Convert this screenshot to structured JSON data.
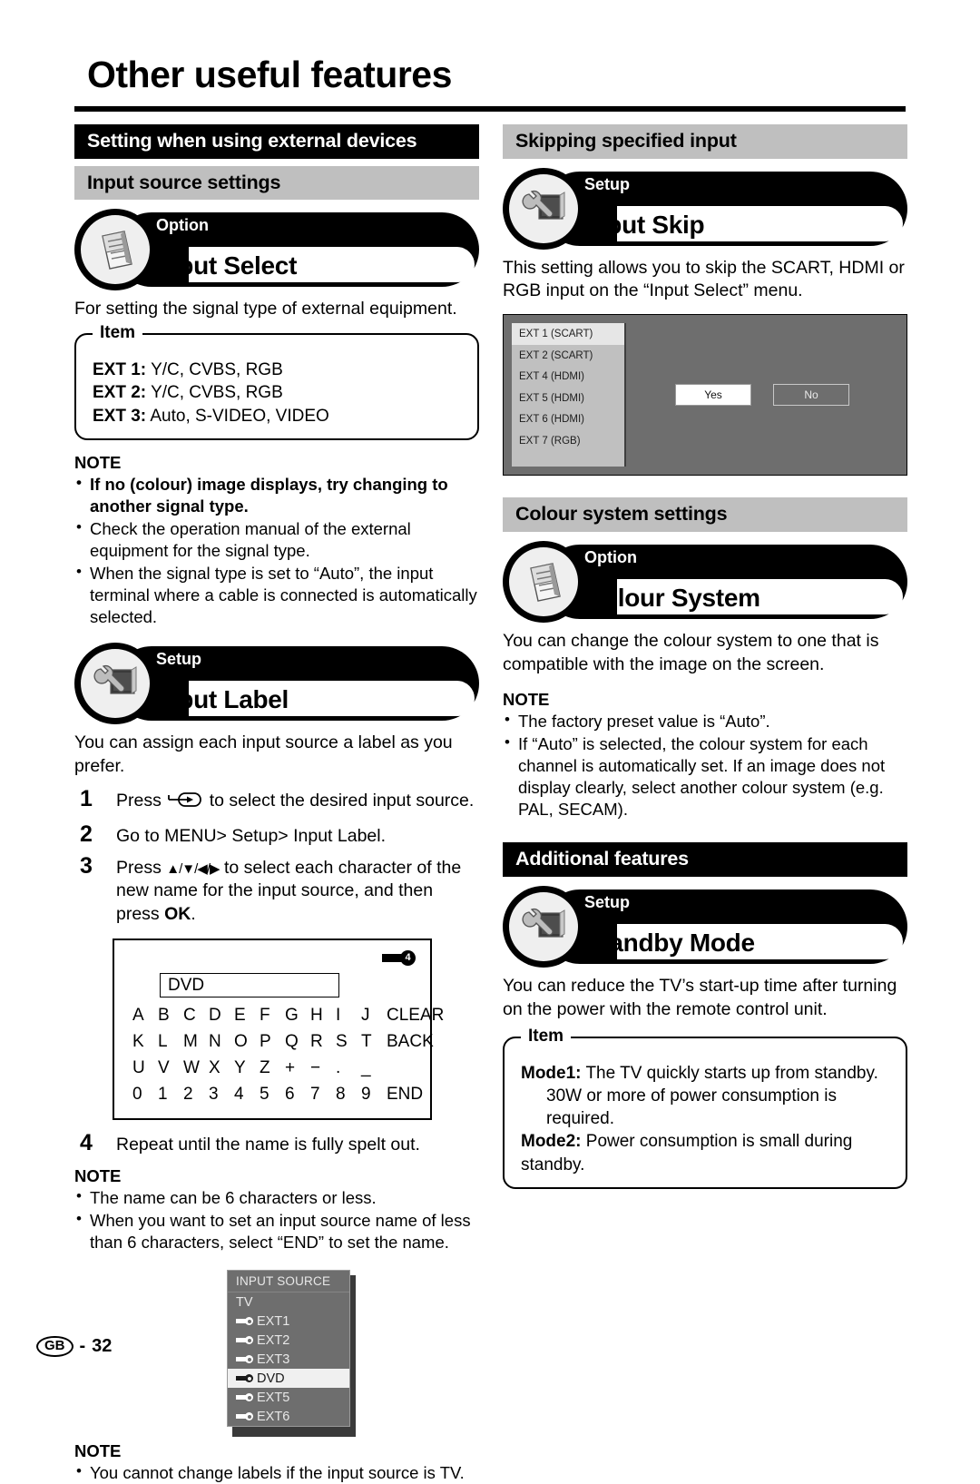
{
  "page": {
    "title": "Other useful features",
    "footer_region": "GB",
    "footer_separator": "-",
    "footer_page": "32"
  },
  "left_column": {
    "section_header": "Setting when using external devices",
    "sub_header": "Input source settings",
    "input_select": {
      "kicker": "Option",
      "name": "Input Select",
      "icon": "clipboard-icon",
      "intro": "For setting the signal type of external equipment.",
      "item_legend": "Item",
      "items": [
        {
          "label": "EXT 1:",
          "value": "Y/C, CVBS, RGB"
        },
        {
          "label": "EXT 2:",
          "value": "Y/C, CVBS, RGB"
        },
        {
          "label": "EXT 3:",
          "value": "Auto, S-VIDEO, VIDEO"
        }
      ],
      "note_title": "NOTE",
      "notes": [
        "If no (colour) image displays, try changing to another signal type.",
        "Check the operation manual of the external equipment for the signal type.",
        "When the signal type is set to “Auto”, the input terminal where a cable is connected is automatically selected."
      ]
    },
    "input_label": {
      "kicker": "Setup",
      "name": "Input Label",
      "icon": "wrench-monitor-icon",
      "intro": "You can assign each input source a label as you prefer.",
      "steps": [
        {
          "num": "1",
          "before": "Press",
          "glyph": "input-source-button-icon",
          "after": "to select the desired input source."
        },
        {
          "num": "2",
          "text": "Go to MENU> Setup> Input Label."
        },
        {
          "num": "3",
          "before": "Press",
          "arrows": "▲/▼/◀/▶",
          "after": "to select each character of the new name for the input source, and then press ",
          "bold": "OK",
          "tail": "."
        },
        {
          "num": "4",
          "text": "Repeat until the name is fully spelt out."
        }
      ],
      "diagram": {
        "callout": "4",
        "name_value": "DVD",
        "rows": [
          [
            "A",
            "B",
            "C",
            "D",
            "E",
            "F",
            "G",
            "H",
            "I",
            "J",
            "CLEAR"
          ],
          [
            "K",
            "L",
            "M",
            "N",
            "O",
            "P",
            "Q",
            "R",
            "S",
            "T",
            "BACK"
          ],
          [
            "U",
            "V",
            "W",
            "X",
            "Y",
            "Z",
            "+",
            "−",
            ".",
            "_",
            ""
          ],
          [
            "0",
            "1",
            "2",
            "3",
            "4",
            "5",
            "6",
            "7",
            "8",
            "9",
            "END"
          ]
        ]
      },
      "note_title": "NOTE",
      "notes": [
        "The name can be 6 characters or less.",
        "When you want to set an input source name of less than 6 characters, select “END” to set the name."
      ],
      "osd": {
        "title": "INPUT SOURCE",
        "rows": [
          {
            "label": "TV",
            "has_plug": false,
            "selected": false
          },
          {
            "label": "EXT1",
            "has_plug": true,
            "selected": false
          },
          {
            "label": "EXT2",
            "has_plug": true,
            "selected": false
          },
          {
            "label": "EXT3",
            "has_plug": true,
            "selected": false
          },
          {
            "label": "DVD",
            "has_plug": true,
            "selected": true
          },
          {
            "label": "EXT5",
            "has_plug": true,
            "selected": false
          },
          {
            "label": "EXT6",
            "has_plug": true,
            "selected": false
          }
        ]
      },
      "final_note_title": "NOTE",
      "final_notes": [
        "You cannot change labels if the input source is TV."
      ]
    }
  },
  "right_column": {
    "skip_header": "Skipping specified input",
    "input_skip": {
      "kicker": "Setup",
      "name": "Input Skip",
      "icon": "wrench-monitor-icon",
      "intro": "This setting allows you to skip the SCART, HDMI or RGB input on the “Input Select” menu.",
      "osd": {
        "items": [
          {
            "label": "EXT 1 (SCART)",
            "selected": true
          },
          {
            "label": "EXT 2 (SCART)",
            "selected": false
          },
          {
            "label": "EXT 4 (HDMI)",
            "selected": false
          },
          {
            "label": "EXT 5 (HDMI)",
            "selected": false
          },
          {
            "label": "EXT 6 (HDMI)",
            "selected": false
          },
          {
            "label": "EXT 7 (RGB)",
            "selected": false
          }
        ],
        "yes_label": "Yes",
        "no_label": "No"
      }
    },
    "colour_header": "Colour system settings",
    "colour_system": {
      "kicker": "Option",
      "name": "Colour System",
      "icon": "clipboard-icon",
      "intro": "You can change the colour system to one that is compatible with the image on the screen.",
      "note_title": "NOTE",
      "notes": [
        "The factory preset value is “Auto”.",
        "If “Auto” is selected, the colour system for each channel is automatically set. If an image does not display clearly, select another colour system (e.g. PAL, SECAM)."
      ]
    },
    "additional_header": "Additional features",
    "standby_mode": {
      "kicker": "Setup",
      "name": "Standby Mode",
      "icon": "wrench-monitor-icon",
      "intro": "You can reduce the TV’s start-up time after turning on the power with the remote control unit.",
      "item_legend": "Item",
      "mode1_label": "Mode1:",
      "mode1_text": "The TV quickly starts up from standby.",
      "mode1_text2": "30W or more of power consumption is required.",
      "mode2_label": "Mode2:",
      "mode2_text": "Power consumption is small during standby."
    }
  }
}
